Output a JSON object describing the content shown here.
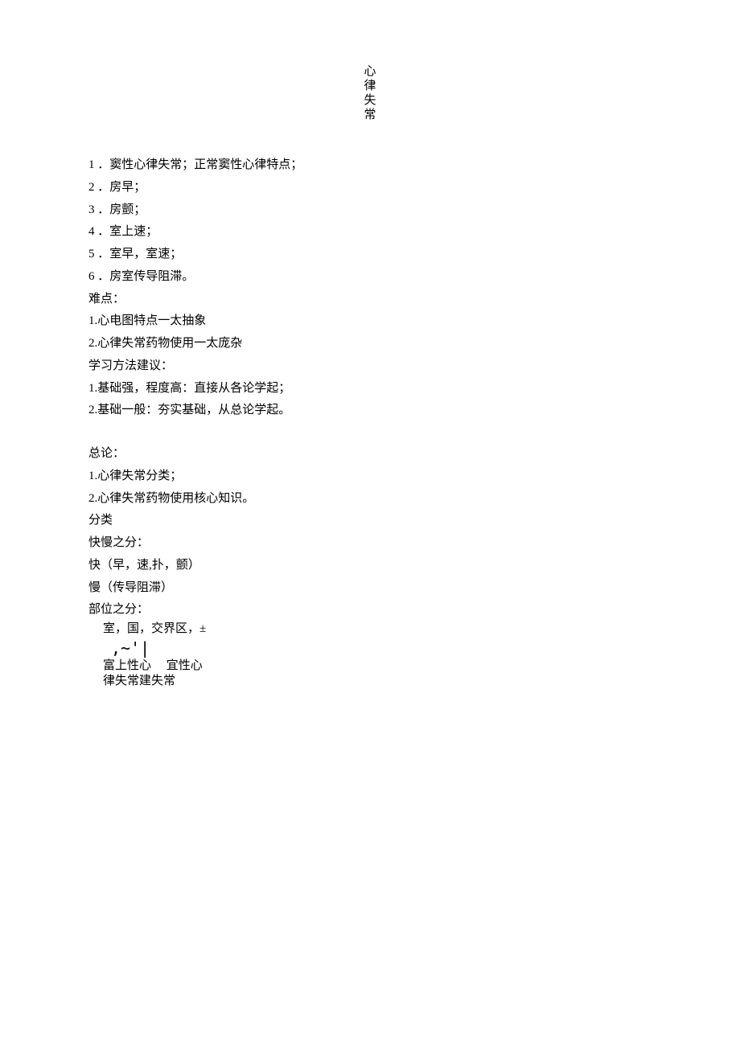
{
  "title": {
    "c1": "心",
    "c2": "律",
    "c3": "失",
    "c4": "常"
  },
  "outline": {
    "item1": "1 ．窦性心律失常；正常窦性心律特点；",
    "item2": "2 ．房早；",
    "item3": "3 ．房颤；",
    "item4": "4 ．室上速；",
    "item5": "5 ．室早，室速；",
    "item6": "6 ．房室传导阻滞。"
  },
  "difficulties": {
    "heading": "难点：",
    "d1": "1.心电图特点一太抽象",
    "d2": "2.心律失常药物使用一太庞杂"
  },
  "methods": {
    "heading": "学习方法建议：",
    "m1": "1.基础强，程度高：直接从各论学起；",
    "m2": "2.基础一般：夯实基础，从总论学起。"
  },
  "general": {
    "heading": "总论：",
    "g1": "1.心律失常分类；",
    "g2": "2.心律失常药物使用核心知识。"
  },
  "classify": {
    "heading": "分类",
    "speed_heading": "快慢之分：",
    "fast": "快（早，速,扑，颤）",
    "slow": "慢（传导阻滞）",
    "location_heading": "部位之分："
  },
  "diagram": {
    "row1": "室，国，交界区，±",
    "row2": ",~'|",
    "row3a": "富上性心",
    "row3b": "宜性心",
    "row4": "律失常建失常"
  }
}
